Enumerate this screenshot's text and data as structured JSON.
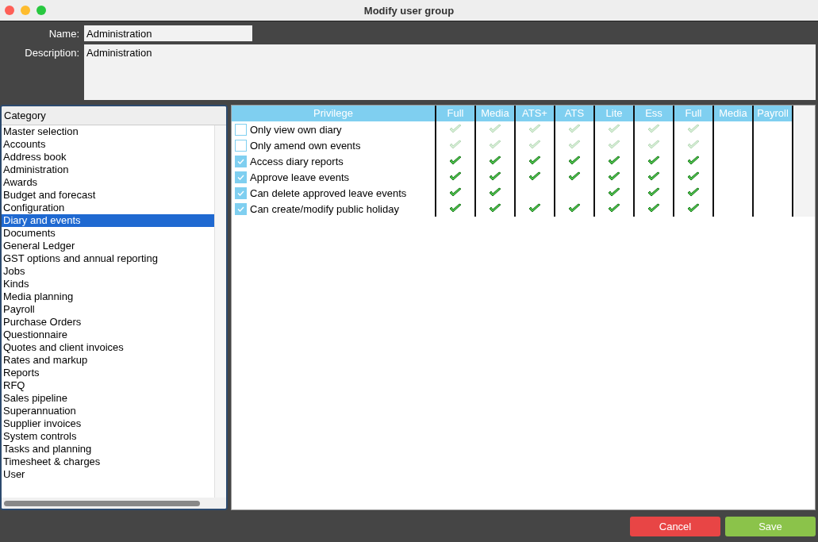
{
  "window": {
    "title": "Modify user group"
  },
  "form": {
    "name_label": "Name:",
    "name_value": "Administration",
    "description_label": "Description:",
    "description_value": "Administration"
  },
  "categories": {
    "header": "Category",
    "items": [
      {
        "label": "Master selection",
        "selected": false
      },
      {
        "label": "Accounts",
        "selected": false
      },
      {
        "label": "Address book",
        "selected": false
      },
      {
        "label": "Administration",
        "selected": false
      },
      {
        "label": "Awards",
        "selected": false
      },
      {
        "label": "Budget and forecast",
        "selected": false
      },
      {
        "label": "Configuration",
        "selected": false
      },
      {
        "label": "Diary and events",
        "selected": true
      },
      {
        "label": "Documents",
        "selected": false
      },
      {
        "label": "General Ledger",
        "selected": false
      },
      {
        "label": "GST options and annual reporting",
        "selected": false
      },
      {
        "label": "Jobs",
        "selected": false
      },
      {
        "label": "Kinds",
        "selected": false
      },
      {
        "label": "Media planning",
        "selected": false
      },
      {
        "label": "Payroll",
        "selected": false
      },
      {
        "label": "Purchase Orders",
        "selected": false
      },
      {
        "label": "Questionnaire",
        "selected": false
      },
      {
        "label": "Quotes and client invoices",
        "selected": false
      },
      {
        "label": "Rates and markup",
        "selected": false
      },
      {
        "label": "Reports",
        "selected": false
      },
      {
        "label": "RFQ",
        "selected": false
      },
      {
        "label": "Sales pipeline",
        "selected": false
      },
      {
        "label": "Superannuation",
        "selected": false
      },
      {
        "label": "Supplier invoices",
        "selected": false
      },
      {
        "label": "System controls",
        "selected": false
      },
      {
        "label": "Tasks and planning",
        "selected": false
      },
      {
        "label": "Timesheet & charges",
        "selected": false
      },
      {
        "label": "User",
        "selected": false
      }
    ]
  },
  "privileges": {
    "columns": [
      "Privilege",
      "Full",
      "Media",
      "ATS+",
      "ATS",
      "Lite",
      "Ess",
      "Full",
      "Media",
      "Payroll"
    ],
    "rows": [
      {
        "label": "Only view own diary",
        "checked": false,
        "cells": [
          {
            "ticked": true,
            "faded": true
          },
          {
            "ticked": true,
            "faded": true
          },
          {
            "ticked": true,
            "faded": true
          },
          {
            "ticked": true,
            "faded": true
          },
          {
            "ticked": true,
            "faded": true
          },
          {
            "ticked": true,
            "faded": true
          },
          {
            "ticked": true,
            "faded": true
          },
          {
            "ticked": false
          },
          {
            "ticked": false
          }
        ]
      },
      {
        "label": "Only amend own events",
        "checked": false,
        "cells": [
          {
            "ticked": true,
            "faded": true
          },
          {
            "ticked": true,
            "faded": true
          },
          {
            "ticked": true,
            "faded": true
          },
          {
            "ticked": true,
            "faded": true
          },
          {
            "ticked": true,
            "faded": true
          },
          {
            "ticked": true,
            "faded": true
          },
          {
            "ticked": true,
            "faded": true
          },
          {
            "ticked": false
          },
          {
            "ticked": false
          }
        ]
      },
      {
        "label": "Access diary reports",
        "checked": true,
        "cells": [
          {
            "ticked": true,
            "faded": false
          },
          {
            "ticked": true,
            "faded": false
          },
          {
            "ticked": true,
            "faded": false
          },
          {
            "ticked": true,
            "faded": false
          },
          {
            "ticked": true,
            "faded": false
          },
          {
            "ticked": true,
            "faded": false
          },
          {
            "ticked": true,
            "faded": false
          },
          {
            "ticked": false
          },
          {
            "ticked": false
          }
        ]
      },
      {
        "label": "Approve leave events",
        "checked": true,
        "cells": [
          {
            "ticked": true,
            "faded": false
          },
          {
            "ticked": true,
            "faded": false
          },
          {
            "ticked": true,
            "faded": false
          },
          {
            "ticked": true,
            "faded": false
          },
          {
            "ticked": true,
            "faded": false
          },
          {
            "ticked": true,
            "faded": false
          },
          {
            "ticked": true,
            "faded": false
          },
          {
            "ticked": false
          },
          {
            "ticked": false
          }
        ]
      },
      {
        "label": "Can delete approved leave events",
        "checked": true,
        "cells": [
          {
            "ticked": true,
            "faded": false
          },
          {
            "ticked": true,
            "faded": false
          },
          {
            "ticked": false
          },
          {
            "ticked": false
          },
          {
            "ticked": true,
            "faded": false
          },
          {
            "ticked": true,
            "faded": false
          },
          {
            "ticked": true,
            "faded": false
          },
          {
            "ticked": false
          },
          {
            "ticked": false
          }
        ]
      },
      {
        "label": "Can create/modify public holiday",
        "checked": true,
        "cells": [
          {
            "ticked": true,
            "faded": false
          },
          {
            "ticked": true,
            "faded": false
          },
          {
            "ticked": true,
            "faded": false
          },
          {
            "ticked": true,
            "faded": false
          },
          {
            "ticked": true,
            "faded": false
          },
          {
            "ticked": true,
            "faded": false
          },
          {
            "ticked": true,
            "faded": false
          },
          {
            "ticked": false
          },
          {
            "ticked": false
          }
        ]
      }
    ]
  },
  "buttons": {
    "cancel": "Cancel",
    "save": "Save"
  }
}
